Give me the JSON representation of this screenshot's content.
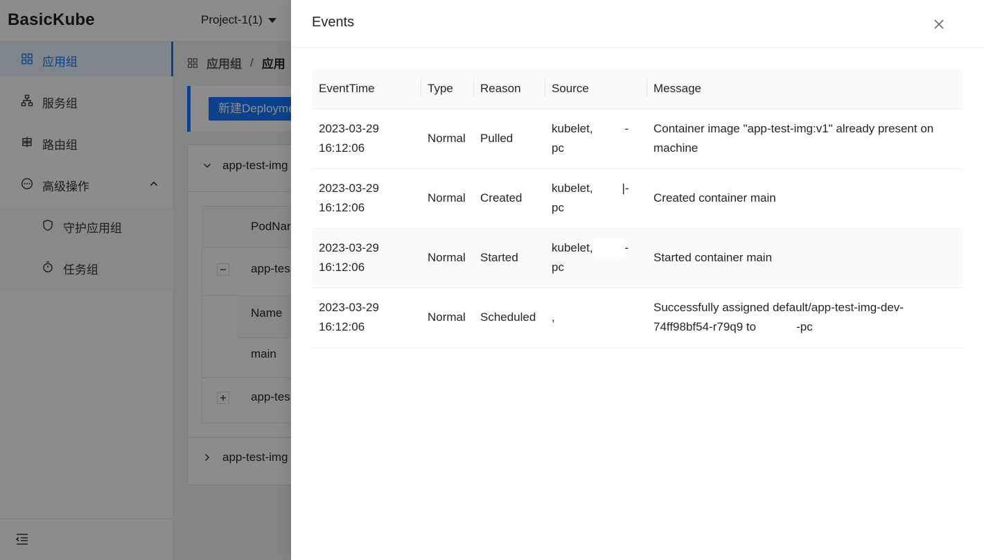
{
  "app": {
    "brand": "BasicKube",
    "project": "Project-1(1)"
  },
  "sidebar": {
    "items": [
      {
        "label": "应用组",
        "icon": "appstore-icon"
      },
      {
        "label": "服务组",
        "icon": "cluster-icon"
      },
      {
        "label": "路由组",
        "icon": "route-icon"
      },
      {
        "label": "高级操作",
        "icon": "ellipsis-circle-icon"
      },
      {
        "label": "守护应用组",
        "icon": "shield-icon"
      },
      {
        "label": "任务组",
        "icon": "timer-icon"
      }
    ]
  },
  "content": {
    "breadcrumb": [
      "应用组",
      "/",
      "应用"
    ],
    "new_button": "新建Deployme",
    "group1_title": "app-test-img",
    "table": {
      "col_podname": "PodNar",
      "row1_name": "app-tes",
      "sub_col_name": "Name",
      "sub_row_name": "main",
      "row2_name": "app-tes"
    },
    "group2_title": "app-test-img"
  },
  "drawer": {
    "title": "Events",
    "columns": [
      "EventTime",
      "Type",
      "Reason",
      "Source",
      "Message"
    ],
    "rows": [
      {
        "time_date": "2023-03-29",
        "time_clock": "16:12:06",
        "type": "Normal",
        "reason": "Pulled",
        "source_a": "kubelet,",
        "source_b": "-",
        "source_c": "pc",
        "message": "Container image \"app-test-img:v1\" already present on machine"
      },
      {
        "time_date": "2023-03-29",
        "time_clock": "16:12:06",
        "type": "Normal",
        "reason": "Created",
        "source_a": "kubelet,",
        "source_b": "|-",
        "source_c": "pc",
        "message": "Created container main"
      },
      {
        "time_date": "2023-03-29",
        "time_clock": "16:12:06",
        "type": "Normal",
        "reason": "Started",
        "source_a": "kubelet,",
        "source_b": "-",
        "source_c": "pc",
        "message": "Started container main"
      },
      {
        "time_date": "2023-03-29",
        "time_clock": "16:12:06",
        "type": "Normal",
        "reason": "Scheduled",
        "source_a": ",",
        "source_b": "",
        "source_c": "",
        "message_line1": "Successfully assigned default/app-test-img-dev-",
        "message_line2a": "74ff98bf54-r79q9 to",
        "message_line2b": "-pc"
      }
    ]
  },
  "colors": {
    "primary": "#1677ff",
    "mask": "rgba(0,0,0,0.45)"
  }
}
